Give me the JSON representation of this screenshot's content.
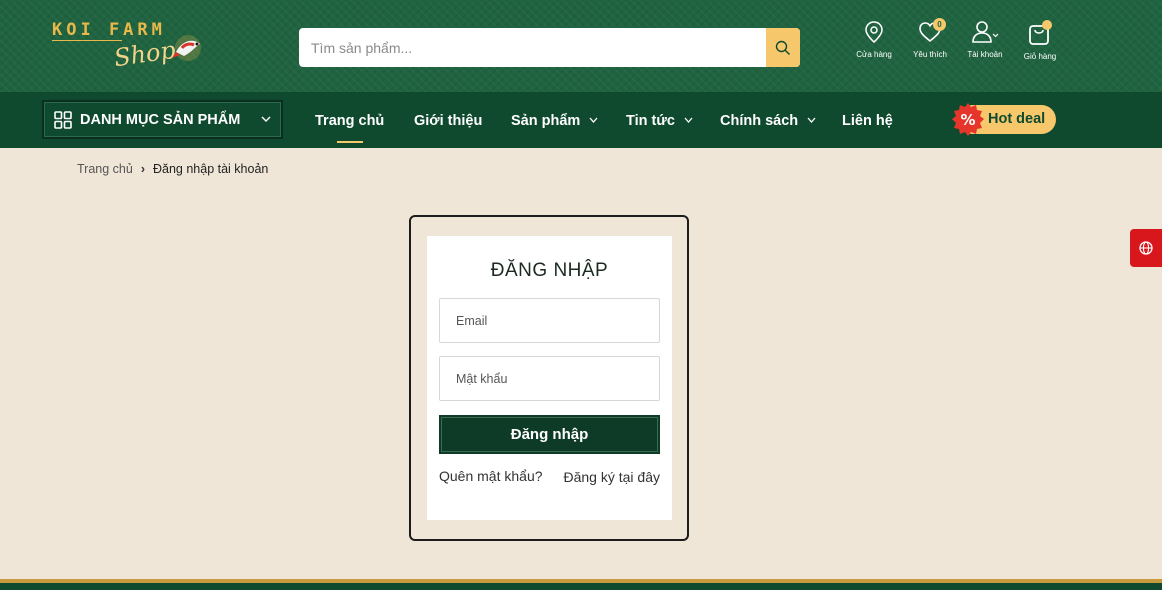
{
  "header": {
    "logo_top": "KOI FARM",
    "logo_script": "Shop",
    "search": {
      "placeholder": "Tìm sản phẩm..."
    },
    "icons": [
      {
        "name": "store",
        "label": "Cửa hàng"
      },
      {
        "name": "wishlist",
        "label": "Yêu thích",
        "badge": "0"
      },
      {
        "name": "account",
        "label": "Tài khoản"
      },
      {
        "name": "cart",
        "label": "Giỏ hàng"
      }
    ]
  },
  "nav": {
    "category_label": "DANH MỤC SẢN PHẨM",
    "items": [
      {
        "label": "Trang chủ",
        "active": true,
        "dropdown": false
      },
      {
        "label": "Giới thiệu",
        "dropdown": false
      },
      {
        "label": "Sản phẩm",
        "dropdown": true
      },
      {
        "label": "Tin tức",
        "dropdown": true
      },
      {
        "label": "Chính sách",
        "dropdown": true
      },
      {
        "label": "Liên hệ",
        "dropdown": false
      }
    ],
    "hot_deal": "Hot deal"
  },
  "breadcrumb": {
    "home": "Trang chủ",
    "separator": "›",
    "current": "Đăng nhập tài khoản"
  },
  "login": {
    "title": "ĐĂNG NHẬP",
    "email_placeholder": "Email",
    "password_placeholder": "Mật khẩu",
    "submit_label": "Đăng nhập",
    "forgot_label": "Quên mật khẩu?",
    "register_label": "Đăng ký tại đây"
  },
  "colors": {
    "header_green": "#1f6340",
    "nav_green": "#0f4a2f",
    "accent_gold": "#f6c86b",
    "page_bg": "#f0e6d8",
    "button_dark": "#0d3b27",
    "side_red": "#d8171d"
  }
}
